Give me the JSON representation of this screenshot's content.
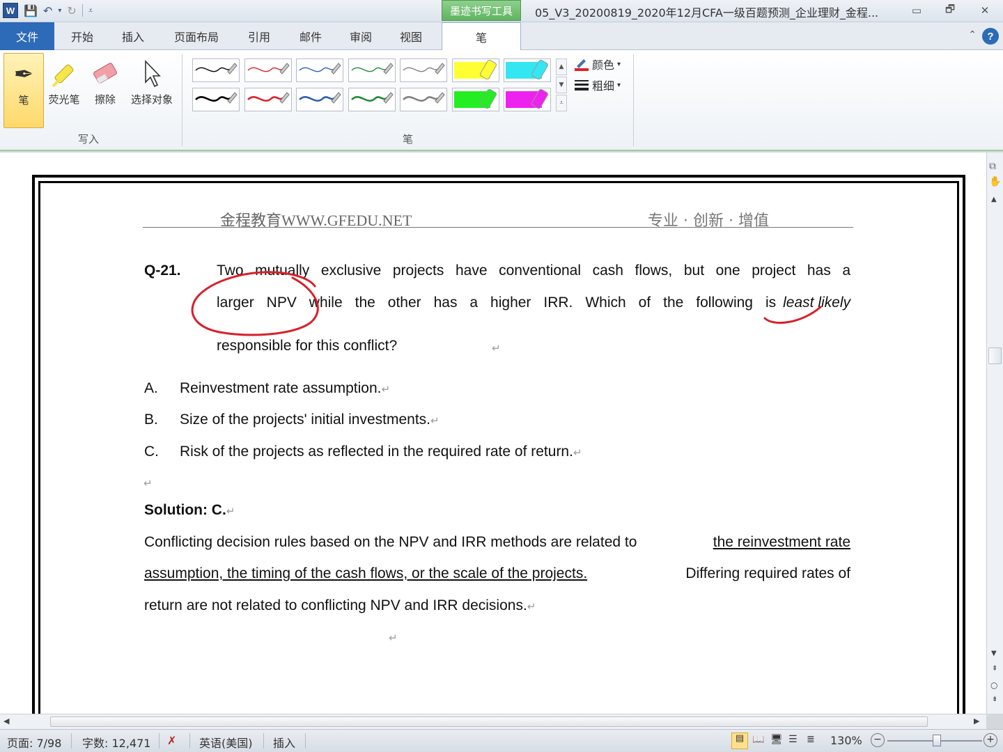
{
  "window": {
    "app_logo": "W",
    "context_tab_group": "墨迹书写工具",
    "title": "05_V3_20200819_2020年12月CFA一级百题预测_企业理财_金程...",
    "controls": [
      "▭",
      "🗗",
      "✕"
    ]
  },
  "tabs": [
    {
      "id": "file",
      "label": "文件"
    },
    {
      "id": "home",
      "label": "开始"
    },
    {
      "id": "insert",
      "label": "插入"
    },
    {
      "id": "layout",
      "label": "页面布局"
    },
    {
      "id": "references",
      "label": "引用"
    },
    {
      "id": "mailings",
      "label": "邮件"
    },
    {
      "id": "review",
      "label": "审阅"
    },
    {
      "id": "view",
      "label": "视图"
    },
    {
      "id": "pen",
      "label": "笔"
    }
  ],
  "help_label": "?",
  "ribbon": {
    "write_group": {
      "label": "写入",
      "buttons": [
        {
          "id": "pen",
          "label": "笔",
          "icon": "pen-icon"
        },
        {
          "id": "highlighter",
          "label": "荧光笔",
          "icon": "highlighter-icon"
        },
        {
          "id": "eraser",
          "label": "擦除",
          "icon": "eraser-icon"
        },
        {
          "id": "select",
          "label": "选择对象",
          "icon": "cursor-icon"
        }
      ]
    },
    "pens_group": {
      "label": "笔",
      "pens": [
        {
          "color": "#000000",
          "weight": "thin"
        },
        {
          "color": "#e0202a",
          "weight": "thin"
        },
        {
          "color": "#2e5fb0",
          "weight": "thin"
        },
        {
          "color": "#1f8a3a",
          "weight": "thin"
        },
        {
          "color": "#808080",
          "weight": "thin"
        },
        {
          "color": "#ffff33",
          "weight": "highlighter"
        },
        {
          "color": "#33e6f2",
          "weight": "highlighter"
        },
        {
          "color": "#000000",
          "weight": "thick"
        },
        {
          "color": "#e0202a",
          "weight": "thick"
        },
        {
          "color": "#2e5fb0",
          "weight": "thick"
        },
        {
          "color": "#1f8a3a",
          "weight": "thick"
        },
        {
          "color": "#808080",
          "weight": "thick"
        },
        {
          "color": "#22ee22",
          "weight": "highlighter"
        },
        {
          "color": "#ee22ee",
          "weight": "highlighter"
        }
      ],
      "color_cmd": "颜色",
      "weight_cmd": "粗细"
    }
  },
  "document": {
    "header_left": "金程教育WWW.GFEDU.NET",
    "header_right": "专业 · 创新 · 增值",
    "question_number": "Q-21.",
    "question_lines": [
      "Two mutually exclusive projects have conventional cash flows, but one project has a",
      "larger NPV while the other has a higher IRR. Which of the following is",
      "responsible for this conflict?"
    ],
    "question_emphasis": "least likely",
    "options": [
      {
        "letter": "A.",
        "text": "Reinvestment rate assumption."
      },
      {
        "letter": "B.",
        "text": "Size of the projects' initial investments."
      },
      {
        "letter": "C.",
        "text": "Risk of the projects as reflected in the required rate of return."
      }
    ],
    "solution_label": "Solution: C.",
    "solution_line1_plain": "Conflicting decision rules based on the NPV and IRR methods are related to",
    "solution_line1_underlined": " the reinvestment rate",
    "solution_line2_underlined": "assumption, the timing of the cash flows, or the scale of the projects.",
    "solution_line2_plain": " Differing required rates of",
    "solution_line3": "return are not related to conflicting NPV and IRR decisions.",
    "paragraph_mark": "↵",
    "ink_color": "#d8202a"
  },
  "status": {
    "page": "页面: 7/98",
    "words": "字数: 12,471",
    "language": "英语(美国)",
    "mode": "插入",
    "zoom": "130%"
  }
}
